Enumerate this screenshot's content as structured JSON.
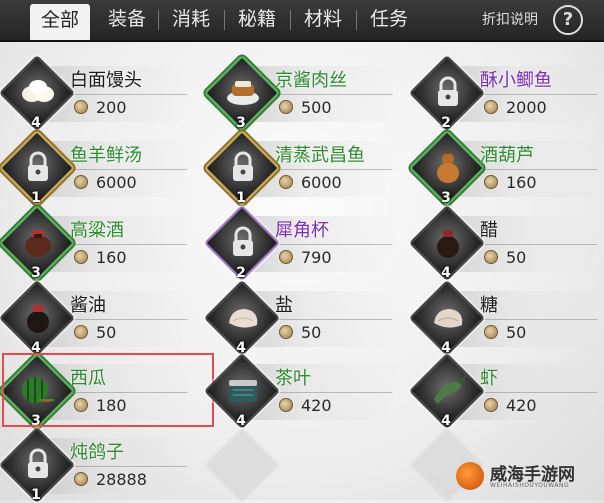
{
  "tabs": [
    "全部",
    "装备",
    "消耗",
    "秘籍",
    "材料",
    "任务"
  ],
  "help_label": "折扣说明",
  "help_icon": "question-mark-icon",
  "items": [
    {
      "name": "白面馒头",
      "price": "200",
      "level": "4",
      "icon": "steamed-bun-icon",
      "locked": false
    },
    {
      "name": "京酱肉丝",
      "price": "500",
      "level": "3",
      "icon": "shredded-pork-icon",
      "locked": false
    },
    {
      "name": "酥小鲫鱼",
      "price": "2000",
      "level": "2",
      "icon": "lock-icon",
      "locked": true
    },
    {
      "name": "鱼羊鲜汤",
      "price": "6000",
      "level": "1",
      "icon": "lock-icon",
      "locked": true
    },
    {
      "name": "清蒸武昌鱼",
      "price": "6000",
      "level": "1",
      "icon": "lock-icon",
      "locked": true
    },
    {
      "name": "酒葫芦",
      "price": "160",
      "level": "3",
      "icon": "gourd-icon",
      "locked": false
    },
    {
      "name": "高粱酒",
      "price": "160",
      "level": "3",
      "icon": "wine-jar-icon",
      "locked": false
    },
    {
      "name": "犀角杯",
      "price": "790",
      "level": "2",
      "icon": "lock-icon",
      "locked": true
    },
    {
      "name": "醋",
      "price": "50",
      "level": "4",
      "icon": "vinegar-jar-icon",
      "locked": false
    },
    {
      "name": "酱油",
      "price": "50",
      "level": "4",
      "icon": "soy-sauce-jar-icon",
      "locked": false
    },
    {
      "name": "盐",
      "price": "50",
      "level": "4",
      "icon": "salt-bag-icon",
      "locked": false
    },
    {
      "name": "糖",
      "price": "50",
      "level": "4",
      "icon": "sugar-bag-icon",
      "locked": false
    },
    {
      "name": "西瓜",
      "price": "180",
      "level": "3",
      "icon": "watermelon-icon",
      "locked": false
    },
    {
      "name": "茶叶",
      "price": "420",
      "level": "4",
      "icon": "tea-box-icon",
      "locked": false
    },
    {
      "name": "虾",
      "price": "420",
      "level": "4",
      "icon": "shrimp-icon",
      "locked": false
    },
    {
      "name": "炖鸽子",
      "price": "28888",
      "level": "1",
      "icon": "lock-icon",
      "locked": true
    }
  ],
  "colors": {
    "green": "#2e8b2e",
    "purple": "#7b2fb0",
    "highlight": "#e44b4b"
  },
  "watermark": {
    "title": "威海手游网",
    "subtitle": "WEIHAISHOUYOUWANG"
  }
}
